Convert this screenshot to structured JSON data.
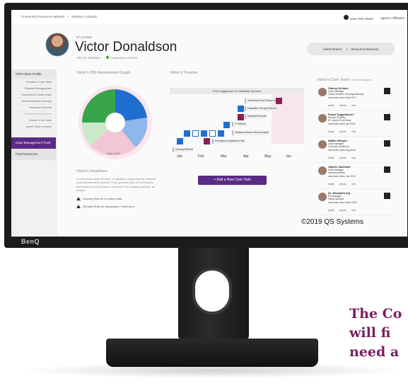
{
  "page": {
    "side_text_lines": [
      "The Co",
      "will fi",
      "need a"
    ],
    "brand": "BenQ",
    "copyright": "©2019 QS Systems"
  },
  "app": {
    "breadcrumb": [
      "Community Resource Network",
      "Western Colorado"
    ],
    "user_label": "User First Name",
    "agency_label": "Agency Affiliation"
  },
  "client": {
    "age_label": "57 yo Male",
    "name": "Victor Donaldson",
    "crn_id": "CRN ID: 40682652",
    "consent": "Consent thru 10/2019"
  },
  "top_actions": {
    "client_search": "Client Search",
    "resource_directory": "Resource Directory"
  },
  "sidebar": {
    "header": "CRN Client Profile",
    "items": [
      "Overview & Care Team",
      "Personal Demographics",
      "Household & Social Graph",
      "Social Indicators Summary",
      "Healthcare Records",
      "Behavioral Health Notes",
      "Content & Doc Vault",
      "search Victor's records"
    ],
    "case_tools": "Case Management Tools",
    "find_resources": "Find Resources"
  },
  "graph": {
    "title": "Victor's 360 Assessment Graph",
    "date_label": "May 2019"
  },
  "headlines": {
    "title": "Victor's Headlines",
    "body": "Lorem ipsum dolor sit amet, consectetur adipiscing elit, Aenean euismod bibendum laoreet. Proin gravida dolor sit amet lacus accumsan et viverra justo commodo. Proin sodales pulvinar ac tempor.",
    "alerts": [
      "Security Risk for In-Home visits",
      "Elevated Risk for Depression / Self-Harm"
    ]
  },
  "timeline": {
    "title": "Victor's Timeline",
    "header": "CRN Suggestion for Disability Services",
    "events": [
      {
        "label": "Scheduled Food Pantry Visit"
      },
      {
        "label": "Outpatient Therapy Referral"
      },
      {
        "label": "Medicaid Renewal"
      },
      {
        "label": "IT Referral"
      },
      {
        "label": "Substance Abuse Group Session"
      },
      {
        "label": "Emergency Department Visit"
      },
      {
        "label": "Housing Referral"
      }
    ],
    "months": [
      "Jan",
      "Feb",
      "Mar",
      "Apr",
      "May",
      "Jun"
    ],
    "add_task": "+ Add a New Care Task"
  },
  "team": {
    "title": "Victor's Care Team",
    "team_messages": "Team Messages",
    "members": [
      {
        "name": "Clancy DeVaux",
        "role": "Case Manager",
        "org": "Grand Junction Housing Authority",
        "since": "care team since May 2017"
      },
      {
        "name": "Frank Tuggelsberrt",
        "role": "Service Provider",
        "org": "St. Mary's Food Bank",
        "since": "care team since Apr 2018"
      },
      {
        "name": "Walter Menyer",
        "role": "Case Manager",
        "org": "Colorado Workforce",
        "since": "care team since Aug 2018"
      },
      {
        "name": "Valerie VanZettle",
        "role": "Case Manager",
        "org": "Veterans Affairs",
        "since": "care team since Jan 2019"
      },
      {
        "name": "Dr. Elizabeth Irty",
        "role": "ED Manager",
        "org": "Hilltop Medical",
        "since": "care team since Sept 2018"
      }
    ],
    "link_labels": {
      "email": "email",
      "phone": "phone",
      "info": "info"
    }
  },
  "colors": {
    "accent": "#5b2a86",
    "graph_blue": "#1f6fd1",
    "graph_green": "#38a54b",
    "graph_pink": "#f2c6d6",
    "side_text": "#7b1f5f"
  }
}
